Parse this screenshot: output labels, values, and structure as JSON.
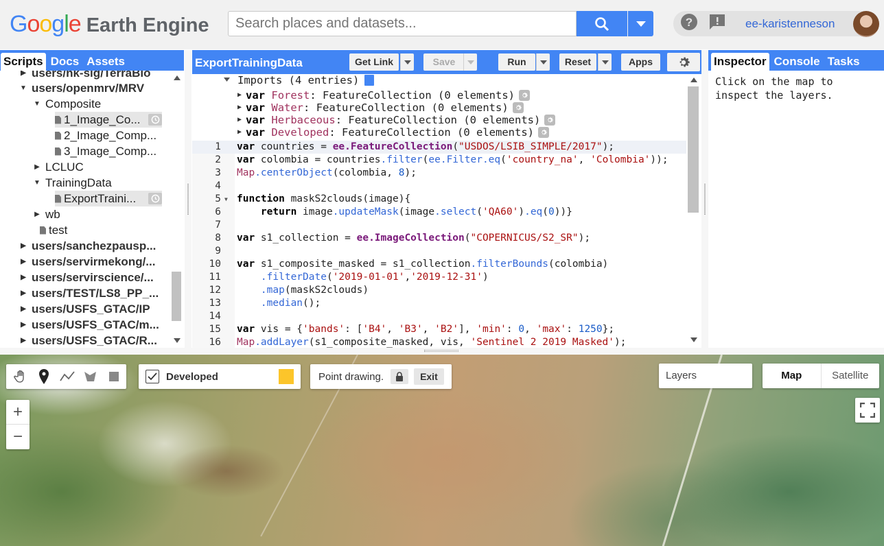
{
  "header": {
    "logo_google": "Google",
    "logo_product": "Earth Engine",
    "search_placeholder": "Search places and datasets...",
    "username": "ee-karistenneson"
  },
  "left_panel": {
    "tabs": [
      "Scripts",
      "Docs",
      "Assets"
    ],
    "tree": [
      {
        "label": "users/nk-sig/TerraBio",
        "bold": true,
        "arrow": "right",
        "indent": 0
      },
      {
        "label": "users/openmrv/MRV",
        "bold": true,
        "arrow": "down",
        "indent": 0
      },
      {
        "label": "Composite",
        "bold": false,
        "arrow": "down",
        "indent": 1
      },
      {
        "label": "1_Image_Co...",
        "bold": false,
        "arrow": "file",
        "indent": 2,
        "selected": true
      },
      {
        "label": "2_Image_Comp...",
        "bold": false,
        "arrow": "file",
        "indent": 2
      },
      {
        "label": "3_Image_Comp...",
        "bold": false,
        "arrow": "file",
        "indent": 2
      },
      {
        "label": "LCLUC",
        "bold": false,
        "arrow": "right",
        "indent": 1
      },
      {
        "label": "TrainingData",
        "bold": false,
        "arrow": "down",
        "indent": 1
      },
      {
        "label": "ExportTraini...",
        "bold": false,
        "arrow": "file",
        "indent": 2,
        "selected": true
      },
      {
        "label": "wb",
        "bold": false,
        "arrow": "right",
        "indent": 1
      },
      {
        "label": "test",
        "bold": false,
        "arrow": "file",
        "indent": 1
      },
      {
        "label": "users/sanchezpausp...",
        "bold": true,
        "arrow": "right",
        "indent": 0
      },
      {
        "label": "users/servirmekong/...",
        "bold": true,
        "arrow": "right",
        "indent": 0
      },
      {
        "label": "users/servirscience/...",
        "bold": true,
        "arrow": "right",
        "indent": 0
      },
      {
        "label": "users/TEST/LS8_PP_...",
        "bold": true,
        "arrow": "right",
        "indent": 0
      },
      {
        "label": "users/USFS_GTAC/IP",
        "bold": true,
        "arrow": "right",
        "indent": 0
      },
      {
        "label": "users/USFS_GTAC/m...",
        "bold": true,
        "arrow": "right",
        "indent": 0
      },
      {
        "label": "users/USFS_GTAC/R...",
        "bold": true,
        "arrow": "right",
        "indent": 0
      }
    ]
  },
  "editor": {
    "title": "ExportTrainingData",
    "buttons": {
      "get_link": "Get Link",
      "save": "Save",
      "run": "Run",
      "reset": "Reset",
      "apps": "Apps"
    },
    "imports_header": "Imports (4 entries)",
    "imports": [
      {
        "name": "Forest",
        "type": "FeatureCollection (0 elements)"
      },
      {
        "name": "Water",
        "type": "FeatureCollection (0 elements)"
      },
      {
        "name": "Herbaceous",
        "type": "FeatureCollection (0 elements)"
      },
      {
        "name": "Developed",
        "type": "FeatureCollection (0 elements)"
      }
    ],
    "lines": [
      "var countries = ee.FeatureCollection(\"USDOS/LSIB_SIMPLE/2017\");",
      "var colombia = countries.filter(ee.Filter.eq('country_na', 'Colombia'));",
      "Map.centerObject(colombia, 8);",
      "",
      "function maskS2clouds(image){",
      "    return image.updateMask(image.select('QA60').eq(0))}",
      "",
      "var s1_collection = ee.ImageCollection(\"COPERNICUS/S2_SR\");",
      "",
      "var s1_composite_masked = s1_collection.filterBounds(colombia)",
      "    .filterDate('2019-01-01','2019-12-31')",
      "    .map(maskS2clouds)",
      "    .median();",
      "",
      "var vis = {'bands': ['B4', 'B3', 'B2'], 'min': 0, 'max': 1250};",
      "Map.addLayer(s1_composite_masked, vis, 'Sentinel 2 2019 Masked');"
    ]
  },
  "right_panel": {
    "tabs": [
      "Inspector",
      "Console",
      "Tasks"
    ],
    "message": "Click on the map to inspect the layers."
  },
  "map": {
    "layer_name": "Developed",
    "layer_color": "#fcc52a",
    "drawing_status": "Point drawing.",
    "exit_label": "Exit",
    "layers_label": "Layers",
    "map_types": [
      "Map",
      "Satellite"
    ],
    "zoom_in": "+",
    "zoom_out": "−"
  }
}
